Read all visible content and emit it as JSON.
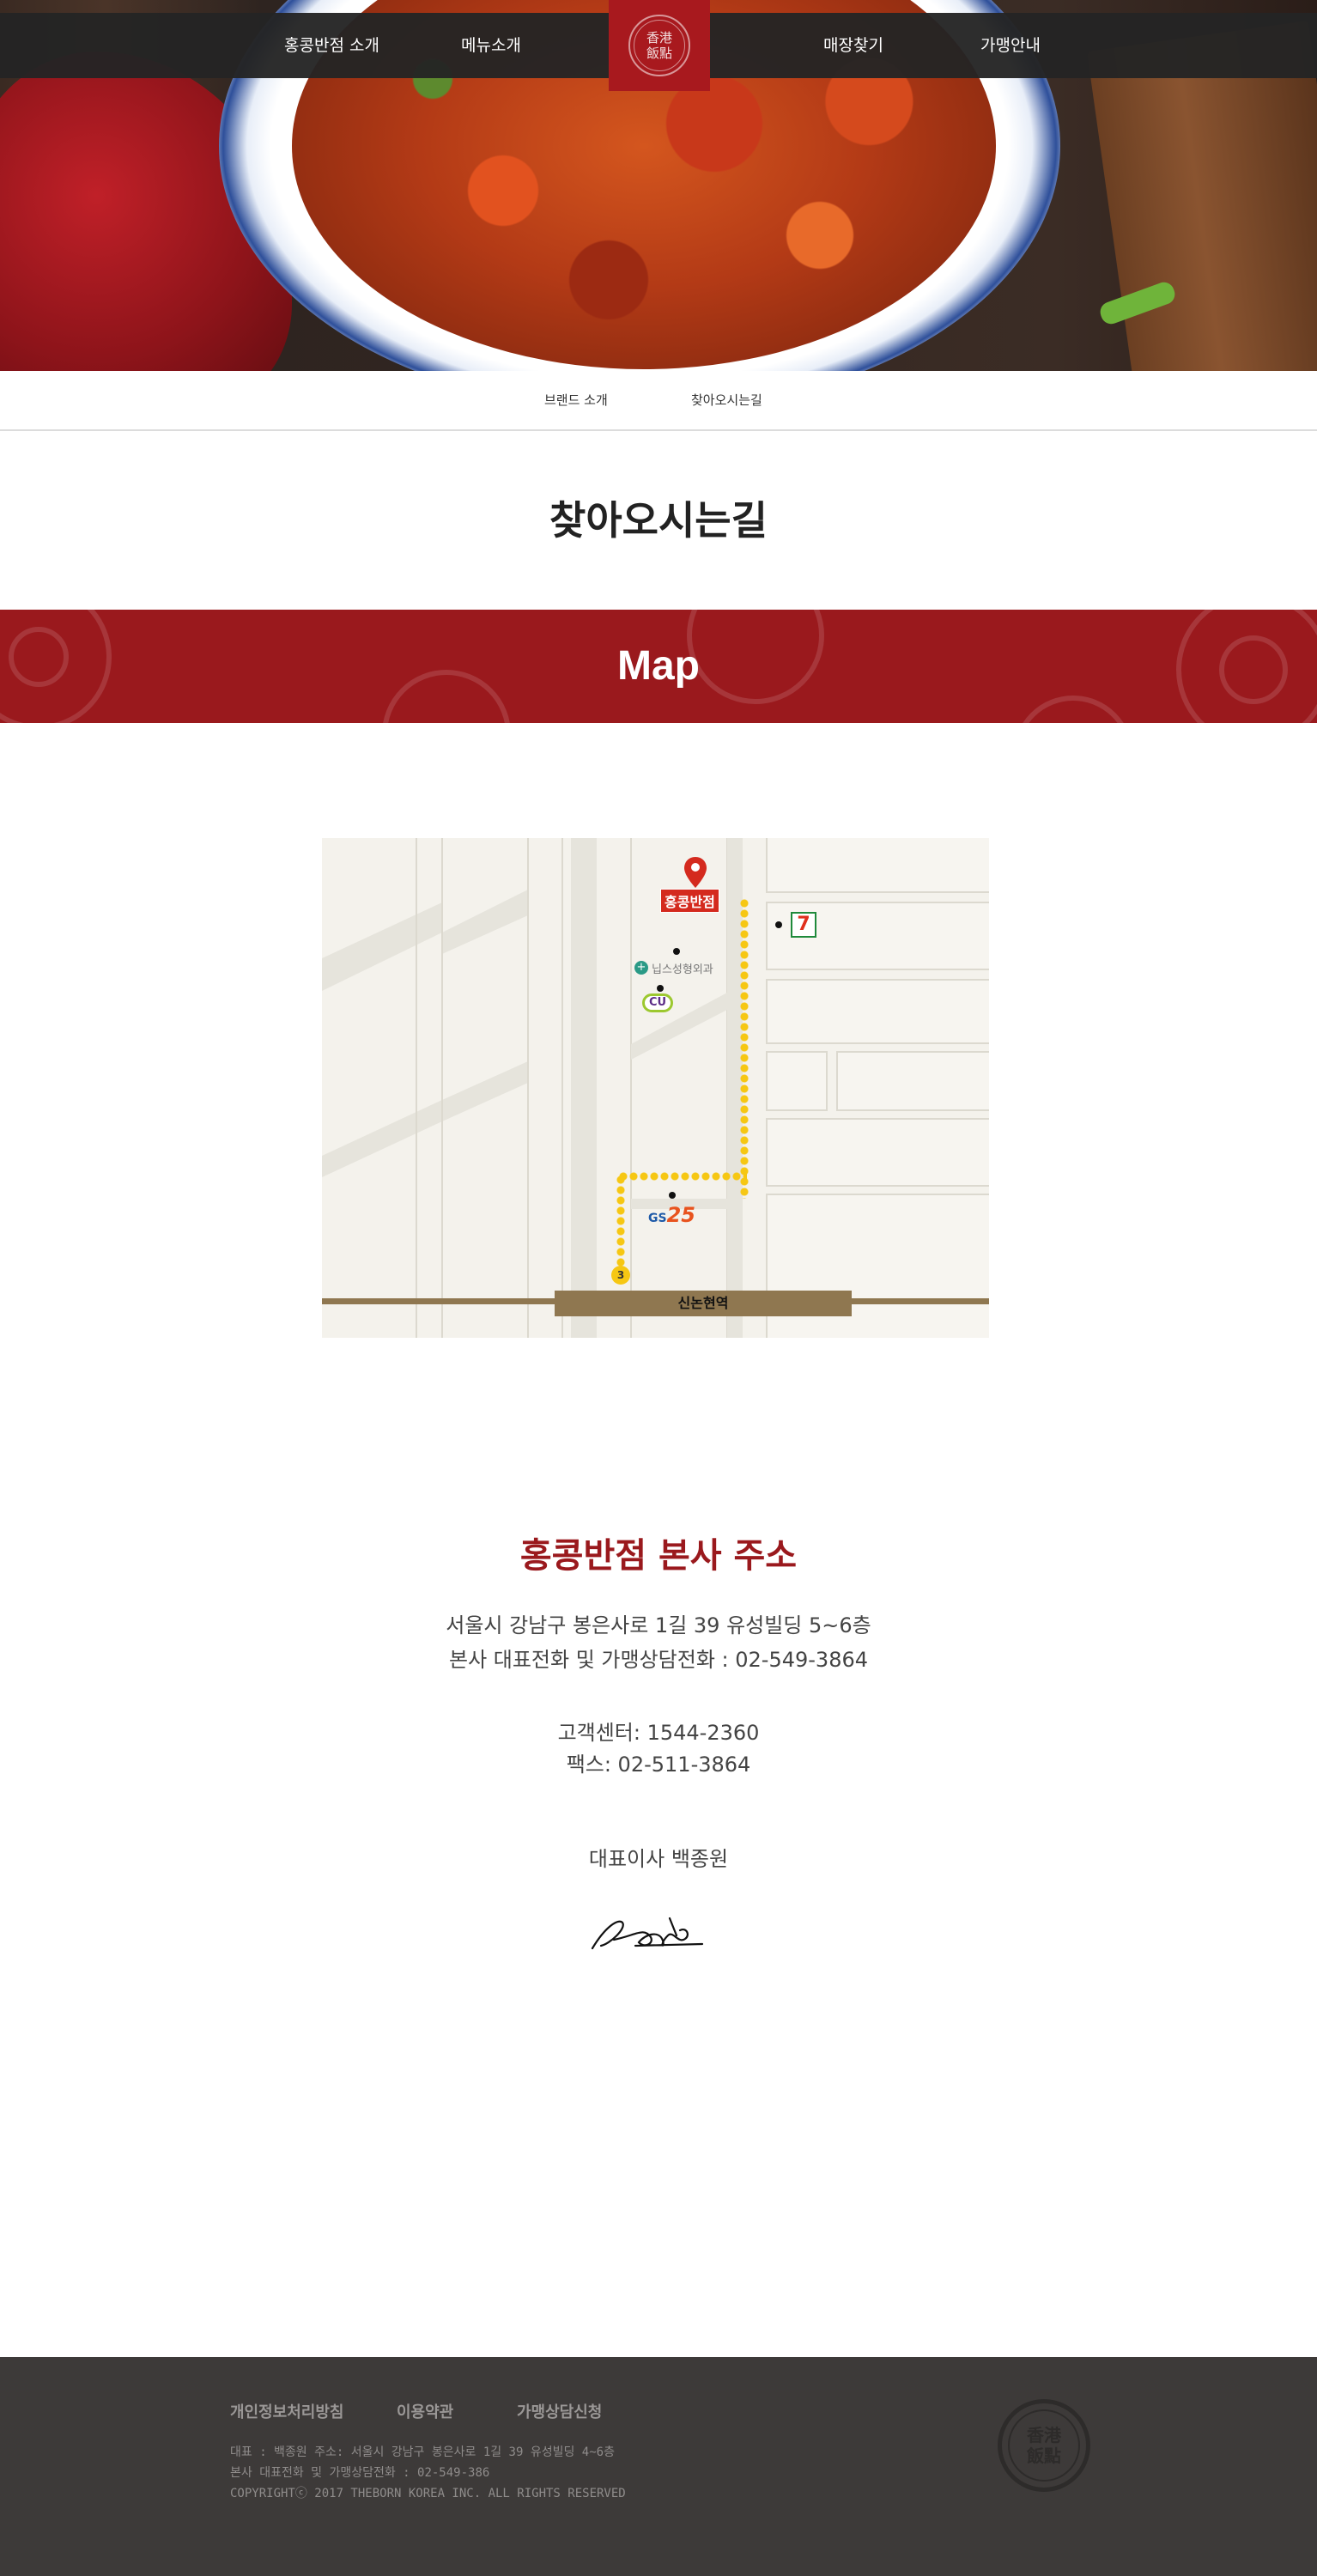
{
  "nav": {
    "items": [
      "홍콩반점 소개",
      "메뉴소개",
      "매장찾기",
      "가맹안내"
    ],
    "logo_chars": [
      "香港",
      "飯點"
    ]
  },
  "subnav": {
    "items": [
      "브랜드 소개",
      "찾아오시는길"
    ]
  },
  "page": {
    "title": "찾아오시는길"
  },
  "map_section": {
    "heading": "Map",
    "labels": {
      "store": "홍콩반점",
      "clinic": "닙스성형외과",
      "station": "신논현역",
      "exit": "3",
      "cu": "CU",
      "gs25_gs": "GS",
      "gs25_num": "25",
      "seven": "7"
    },
    "colors": {
      "route": "#f6c713",
      "pin": "#d42a1e",
      "rail": "#8f7750"
    }
  },
  "address": {
    "title": "홍콩반점 본사 주소",
    "line1": "서울시 강남구 봉은사로 1길 39 유성빌딩 5~6층",
    "line2": "본사 대표전화 및 가맹상담전화 : 02-549-3864",
    "line3": "고객센터: 1544-2360",
    "line4": "팩스: 02-511-3864",
    "ceo": "대표이사 백종원"
  },
  "footer": {
    "links": [
      "개인정보처리방침",
      "이용약관",
      "가맹상담신청"
    ],
    "info1": "대표 : 백종원  주소: 서울시 강남구 봉은사로 1길 39 유성빌딩 4~6층",
    "info2": "본사 대표전화 및 가맹상담전화 : 02-549-386",
    "info3": "COPYRIGHTⓒ 2017 THEBORN KOREA INC. ALL RIGHTS RESERVED",
    "seal_chars": [
      "香港",
      "飯點"
    ]
  },
  "colors": {
    "brand_red": "#9a191d",
    "nav_bg": "#242424",
    "footer_bg": "#3d3a39"
  }
}
